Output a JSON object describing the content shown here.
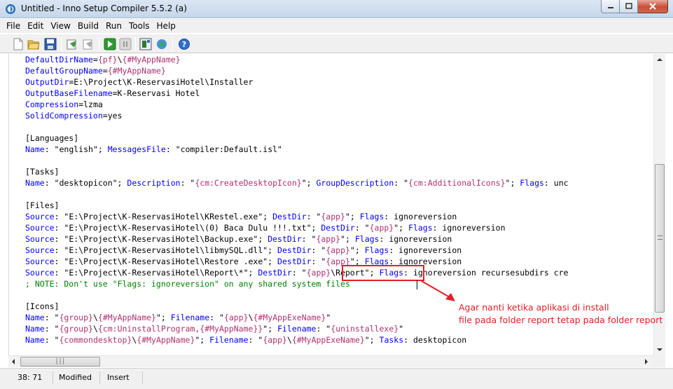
{
  "window": {
    "title": "Untitled - Inno Setup Compiler 5.5.2 (a)",
    "icon": "inno-setup-icon",
    "buttons": {
      "minimize": "minimize",
      "maximize": "maximize",
      "close": "close"
    }
  },
  "menu": [
    "File",
    "Edit",
    "View",
    "Build",
    "Run",
    "Tools",
    "Help"
  ],
  "toolbar": [
    "new-file-icon",
    "open-folder-icon",
    "save-icon",
    "compile-icon",
    "stop-compile-icon",
    "run-icon",
    "pause-icon",
    "target-icon",
    "wizard-icon",
    "help-icon"
  ],
  "editor": {
    "lines": [
      [
        [
          "k",
          "DefaultDirName"
        ],
        [
          "s",
          "="
        ],
        [
          "m",
          "{pf}"
        ],
        [
          "s",
          "\\"
        ],
        [
          "m",
          "{#MyAppName}"
        ]
      ],
      [
        [
          "k",
          "DefaultGroupName"
        ],
        [
          "s",
          "="
        ],
        [
          "m",
          "{#MyAppName}"
        ]
      ],
      [
        [
          "k",
          "OutputDir"
        ],
        [
          "s",
          "=E:\\Project\\K-ReservasiHotel\\Installer"
        ]
      ],
      [
        [
          "k",
          "OutputBaseFilename"
        ],
        [
          "s",
          "=K-Reservasi Hotel"
        ]
      ],
      [
        [
          "k",
          "Compression"
        ],
        [
          "s",
          "=lzma"
        ]
      ],
      [
        [
          "k",
          "SolidCompression"
        ],
        [
          "s",
          "=yes"
        ]
      ],
      [],
      [
        [
          "sec",
          "[Languages]"
        ]
      ],
      [
        [
          "k",
          "Name"
        ],
        [
          "s",
          ": \"english\"; "
        ],
        [
          "k",
          "MessagesFile"
        ],
        [
          "s",
          ": \"compiler:Default.isl\""
        ]
      ],
      [],
      [
        [
          "sec",
          "[Tasks]"
        ]
      ],
      [
        [
          "k",
          "Name"
        ],
        [
          "s",
          ": \"desktopicon\"; "
        ],
        [
          "k",
          "Description"
        ],
        [
          "s",
          ": \""
        ],
        [
          "m",
          "{cm:CreateDesktopIcon}"
        ],
        [
          "s",
          "\"; "
        ],
        [
          "k",
          "GroupDescription"
        ],
        [
          "s",
          ": \""
        ],
        [
          "m",
          "{cm:AdditionalIcons}"
        ],
        [
          "s",
          "\"; "
        ],
        [
          "k",
          "Flags"
        ],
        [
          "s",
          ": unc"
        ]
      ],
      [],
      [
        [
          "sec",
          "[Files]"
        ]
      ],
      [
        [
          "k",
          "Source"
        ],
        [
          "s",
          ": \"E:\\Project\\K-ReservasiHotel\\KRestel.exe\"; "
        ],
        [
          "k",
          "DestDir"
        ],
        [
          "s",
          ": \""
        ],
        [
          "m",
          "{app}"
        ],
        [
          "s",
          "\"; "
        ],
        [
          "k",
          "Flags"
        ],
        [
          "s",
          ": ignoreversion"
        ]
      ],
      [
        [
          "k",
          "Source"
        ],
        [
          "s",
          ": \"E:\\Project\\K-ReservasiHotel\\(0) Baca Dulu !!!.txt\"; "
        ],
        [
          "k",
          "DestDir"
        ],
        [
          "s",
          ": \""
        ],
        [
          "m",
          "{app}"
        ],
        [
          "s",
          "\"; "
        ],
        [
          "k",
          "Flags"
        ],
        [
          "s",
          ": ignoreversion"
        ]
      ],
      [
        [
          "k",
          "Source"
        ],
        [
          "s",
          ": \"E:\\Project\\K-ReservasiHotel\\Backup.exe\"; "
        ],
        [
          "k",
          "DestDir"
        ],
        [
          "s",
          ": \""
        ],
        [
          "m",
          "{app}"
        ],
        [
          "s",
          "\"; "
        ],
        [
          "k",
          "Flags"
        ],
        [
          "s",
          ": ignoreversion"
        ]
      ],
      [
        [
          "k",
          "Source"
        ],
        [
          "s",
          ": \"E:\\Project\\K-ReservasiHotel\\libmySQL.dll\"; "
        ],
        [
          "k",
          "DestDir"
        ],
        [
          "s",
          ": \""
        ],
        [
          "m",
          "{app}"
        ],
        [
          "s",
          "\"; "
        ],
        [
          "k",
          "Flags"
        ],
        [
          "s",
          ": ignoreversion"
        ]
      ],
      [
        [
          "k",
          "Source"
        ],
        [
          "s",
          ": \"E:\\Project\\K-ReservasiHotel\\Restore .exe\"; "
        ],
        [
          "k",
          "DestDir"
        ],
        [
          "s",
          ": \""
        ],
        [
          "m",
          "{app}"
        ],
        [
          "s",
          "\"; "
        ],
        [
          "k",
          "Flags"
        ],
        [
          "s",
          ": ignoreversion"
        ]
      ],
      [
        [
          "k",
          "Source"
        ],
        [
          "s",
          ": \"E:\\Project\\K-ReservasiHotel\\Report\\*\"; "
        ],
        [
          "k",
          "DestDir"
        ],
        [
          "s",
          ": \""
        ],
        [
          "m",
          "{app}"
        ],
        [
          "s",
          "\\Report\"; "
        ],
        [
          "k",
          "Flags"
        ],
        [
          "s",
          ": ignoreversion recursesubdirs cre"
        ]
      ],
      [
        [
          "cm",
          "; NOTE: Don't use \"Flags: ignoreversion\" on any shared system files"
        ]
      ],
      [],
      [
        [
          "sec",
          "[Icons]"
        ]
      ],
      [
        [
          "k",
          "Name"
        ],
        [
          "s",
          ": \""
        ],
        [
          "m",
          "{group}"
        ],
        [
          "s",
          "\\"
        ],
        [
          "m",
          "{#MyAppName}"
        ],
        [
          "s",
          "\"; "
        ],
        [
          "k",
          "Filename"
        ],
        [
          "s",
          ": \""
        ],
        [
          "m",
          "{app}"
        ],
        [
          "s",
          "\\"
        ],
        [
          "m",
          "{#MyAppExeName}"
        ],
        [
          "s",
          "\""
        ]
      ],
      [
        [
          "k",
          "Name"
        ],
        [
          "s",
          ": \""
        ],
        [
          "m",
          "{group}"
        ],
        [
          "s",
          "\\"
        ],
        [
          "m",
          "{cm:UninstallProgram,{#MyAppName}}"
        ],
        [
          "s",
          "\"; "
        ],
        [
          "k",
          "Filename"
        ],
        [
          "s",
          ": \""
        ],
        [
          "m",
          "{uninstallexe}"
        ],
        [
          "s",
          "\""
        ]
      ],
      [
        [
          "k",
          "Name"
        ],
        [
          "s",
          ": \""
        ],
        [
          "m",
          "{commondesktop}"
        ],
        [
          "s",
          "\\"
        ],
        [
          "m",
          "{#MyAppName}"
        ],
        [
          "s",
          "\"; "
        ],
        [
          "k",
          "Filename"
        ],
        [
          "s",
          ": \""
        ],
        [
          "m",
          "{app}"
        ],
        [
          "s",
          "\\"
        ],
        [
          "m",
          "{#MyAppExeName}"
        ],
        [
          "s",
          "\"; "
        ],
        [
          "k",
          "Tasks"
        ],
        [
          "s",
          ": desktopicon"
        ]
      ]
    ]
  },
  "status": {
    "position": "38:  71",
    "modified": "Modified",
    "mode": "Insert"
  },
  "annotation": {
    "line1": "Agar nanti ketika aplikasi di install",
    "line2": "file pada folder report tetap pada folder report",
    "color": "#e31e24"
  },
  "colors": {
    "keyword": "#0000ff",
    "constant": "#b03070",
    "comment": "#008000",
    "annotation": "#e31e24"
  }
}
